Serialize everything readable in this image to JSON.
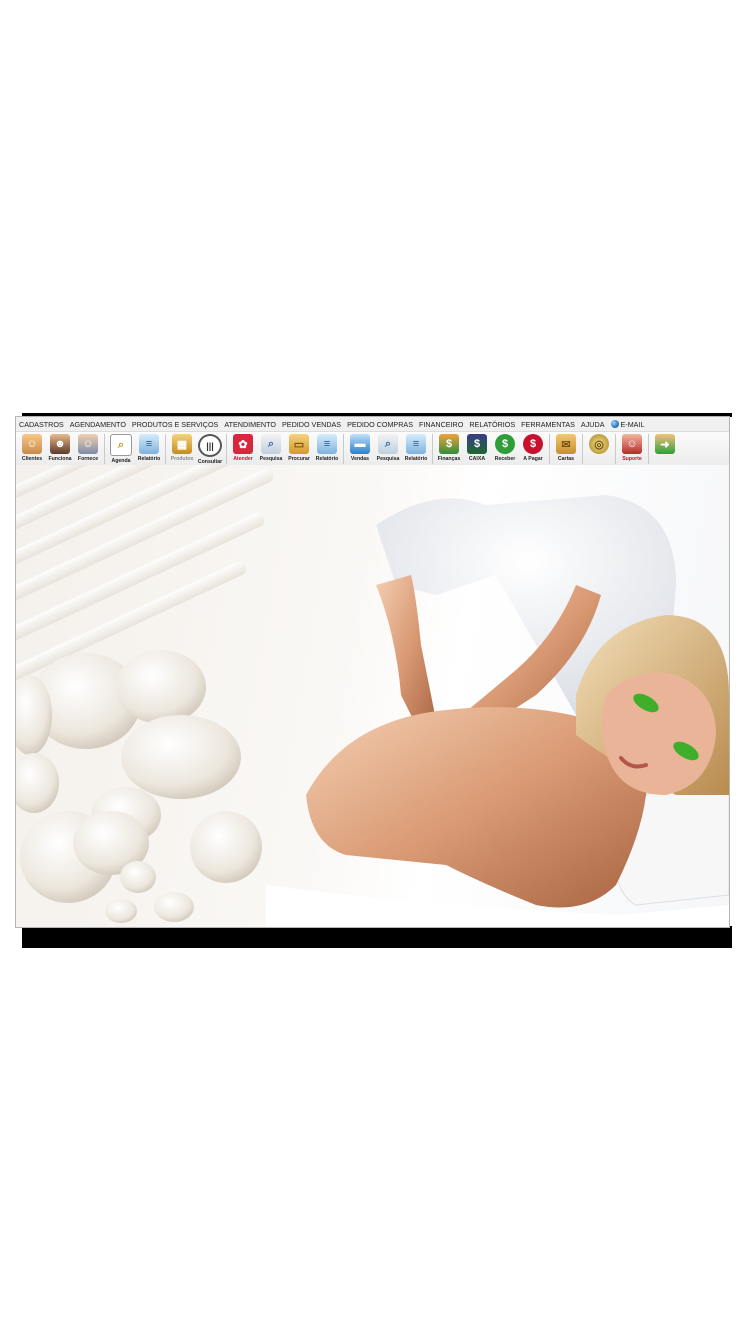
{
  "menu": {
    "items": [
      "CADASTROS",
      "AGENDAMENTO",
      "PRODUTOS E SERVIÇOS",
      "ATENDIMENTO",
      "PEDIDO VENDAS",
      "PEDIDO COMPRAS",
      "FINANCEIRO",
      "RELATÓRIOS",
      "FERRAMENTAS",
      "AJUDA"
    ],
    "email": "E-MAIL"
  },
  "toolbar": {
    "clientes": "Clientes",
    "funcionarios": "Funciona",
    "fornecedores": "Fornece",
    "agenda": "Agenda",
    "relatorio_agenda": "Relatório",
    "produtos": "Produtos",
    "consultar": "Consultar",
    "atender": "Atender",
    "pesquisa_atend": "Pesquisa",
    "procurar": "Procurar",
    "relatorio_atend": "Relatório",
    "vendas": "Vendas",
    "pesquisa_vendas": "Pesquisa",
    "relatorio_vendas": "Relatório",
    "financas": "Finanças",
    "caixa": "CAIXA",
    "receber": "Receber",
    "a_pagar": "A Pagar",
    "cartas": "Cartas",
    "suporte": "Suporte"
  },
  "colors": {
    "menubar_bg": "#f0f0f0",
    "toolbar_bg": "#ececec",
    "accent_red": "#c8102e",
    "money_green": "#2e9e3a"
  },
  "icons": [
    "clients-icon",
    "employees-icon",
    "suppliers-icon",
    "agenda-icon",
    "report-icon",
    "products-icon",
    "barcode-icon",
    "attend-icon",
    "search-doc-icon",
    "folder-icon",
    "report-icon",
    "sales-icon",
    "search-doc-icon",
    "report-icon",
    "finance-icon",
    "cash-register-icon",
    "receive-money-icon",
    "pay-money-icon",
    "letters-icon",
    "coin-icon",
    "support-icon",
    "exit-icon"
  ]
}
